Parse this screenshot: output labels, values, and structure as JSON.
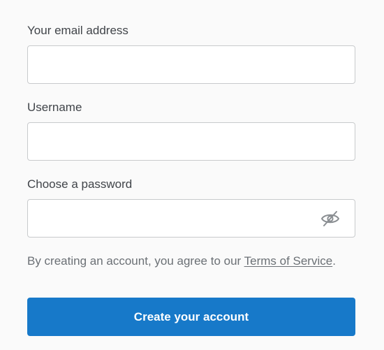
{
  "form": {
    "email": {
      "label": "Your email address",
      "value": "",
      "placeholder": ""
    },
    "username": {
      "label": "Username",
      "value": "",
      "placeholder": ""
    },
    "password": {
      "label": "Choose a password",
      "value": "",
      "placeholder": "",
      "toggle_icon": "eye-slash-icon"
    },
    "terms": {
      "prefix": "By creating an account, you agree to our ",
      "link_text": "Terms of Service",
      "suffix": "."
    },
    "submit_label": "Create your account"
  },
  "colors": {
    "background": "#fafafa",
    "accent": "#1779c9",
    "input_border": "#c8cacc",
    "label_text": "#404449",
    "muted_text": "#6b7075"
  }
}
